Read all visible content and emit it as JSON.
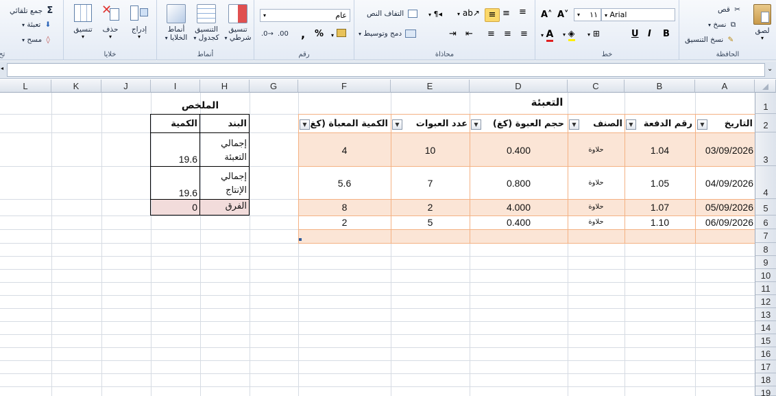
{
  "ribbon": {
    "editing": {
      "autosum": "جمع تلقائي",
      "fill": "تعبئة",
      "clear": "مسح",
      "sort_partial": "تح"
    },
    "cells": {
      "label": "خلايا",
      "insert": "إدراج",
      "delete": "حذف",
      "format": "تنسيق"
    },
    "styles": {
      "label": "أنماط",
      "cell_styles_line1": "أنماط",
      "cell_styles_line2": "الخلايا",
      "format_table_line1": "التنسيق",
      "format_table_line2": "كجدول",
      "conditional_line1": "تنسيق",
      "conditional_line2": "شرطي"
    },
    "number": {
      "label": "رقم",
      "format_value": "عام",
      "percent": "%",
      "comma": ","
    },
    "alignment": {
      "label": "محاذاة",
      "wrap_text": "التفاف النص",
      "merge_center": "دمج وتوسيط"
    },
    "font": {
      "label": "خط",
      "font_name": "Arial",
      "font_size": "١١",
      "bold": "B",
      "italic": "I",
      "underline": "U"
    },
    "clipboard": {
      "label": "الحافظة",
      "paste": "لصق",
      "cut": "قص",
      "copy": "نسخ",
      "format_painter": "نسخ التنسيق"
    }
  },
  "formula_bar": {
    "value": ""
  },
  "columns": [
    "A",
    "B",
    "C",
    "D",
    "E",
    "F",
    "G",
    "H",
    "I",
    "J",
    "K",
    "L"
  ],
  "rows": [
    "1",
    "2",
    "3",
    "4",
    "5",
    "6",
    "7",
    "8",
    "9",
    "10",
    "11",
    "12",
    "13",
    "14",
    "15",
    "16",
    "17",
    "18",
    "19"
  ],
  "packing": {
    "title": "التعبئة",
    "headers": [
      "التاريخ",
      "رقم الدفعة",
      "الصنف",
      "حجم العبوة (كغ)",
      "عدد العبوات",
      "الكمية المعبأة (كغ)"
    ],
    "rows": [
      {
        "date": "03/09/2026",
        "batch": "1.04",
        "item": "حلاوة",
        "size": "0.400",
        "count": "10",
        "qty": "4"
      },
      {
        "date": "04/09/2026",
        "batch": "1.05",
        "item": "حلاوة",
        "size": "0.800",
        "count": "7",
        "qty": "5.6"
      },
      {
        "date": "05/09/2026",
        "batch": "1.07",
        "item": "حلاوة",
        "size": "4.000",
        "count": "2",
        "qty": "8"
      },
      {
        "date": "06/09/2026",
        "batch": "1.10",
        "item": "حلاوة",
        "size": "0.400",
        "count": "5",
        "qty": "2"
      }
    ]
  },
  "summary": {
    "title": "الملخص",
    "header_item": "البند",
    "header_qty": "الكمية",
    "rows": [
      {
        "item_line1": "إجمالي",
        "item_line2": "التعبئة",
        "qty": "19.6"
      },
      {
        "item_line1": "إجمالي",
        "item_line2": "الإنتاج",
        "qty": "19.6"
      },
      {
        "item_line1": "الفرق",
        "item_line2": "",
        "qty": "0"
      }
    ]
  },
  "colors": {
    "table_band": "#fbe5d6",
    "table_border": "#f4b183",
    "diff_fill": "#f2dcdb"
  }
}
